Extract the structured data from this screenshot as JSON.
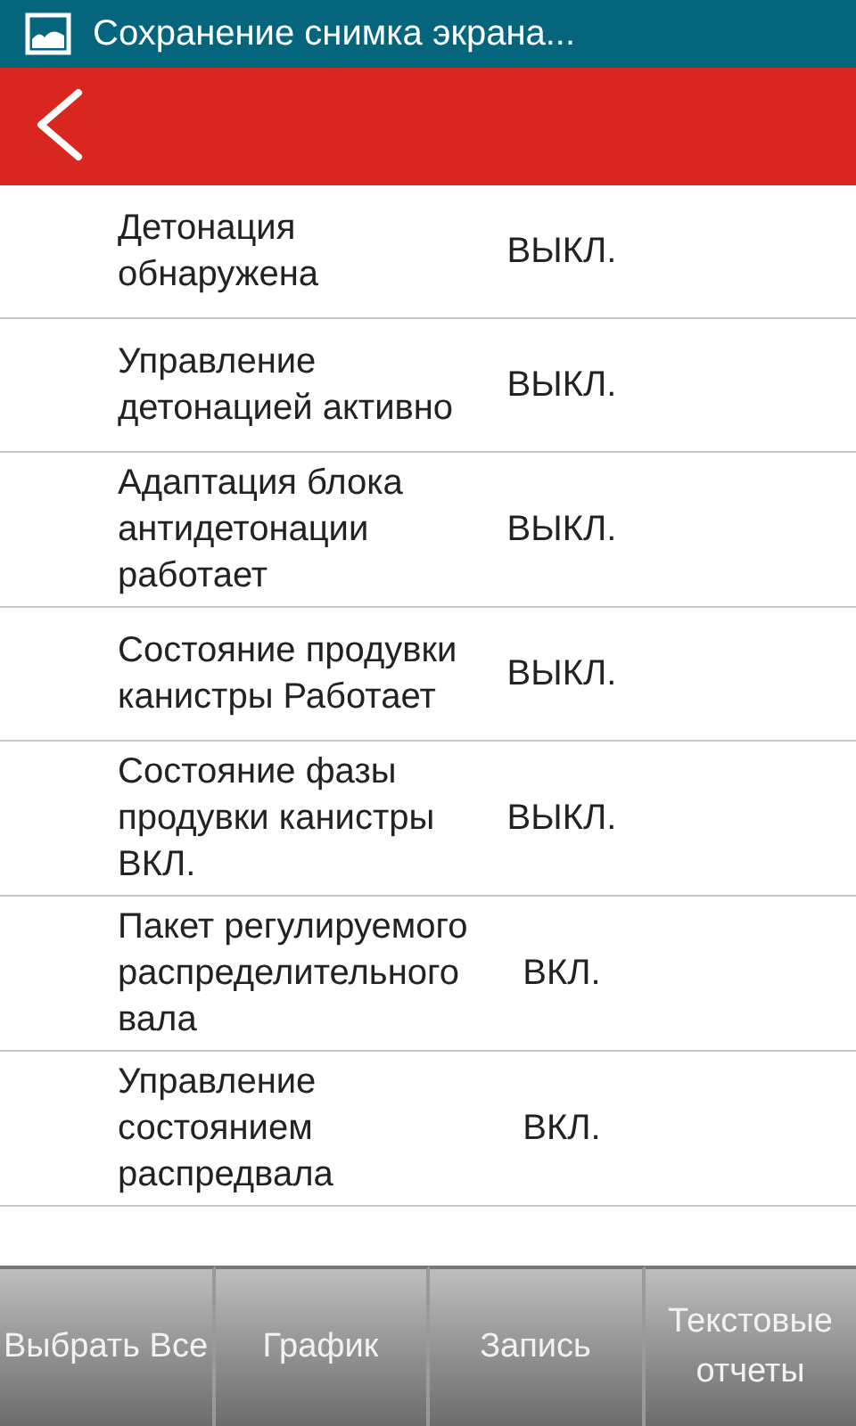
{
  "status_bar": {
    "notification": "Сохранение снимка экрана..."
  },
  "rows": [
    {
      "label": "Детонация обнаружена",
      "value": "ВЫКЛ."
    },
    {
      "label": "Управление детонацией активно",
      "value": "ВЫКЛ."
    },
    {
      "label": "Адаптация блока антидетонации работает",
      "value": "ВЫКЛ."
    },
    {
      "label": "Состояние продувки канистры Работает",
      "value": "ВЫКЛ."
    },
    {
      "label": "Состояние фазы продувки канистры ВКЛ.",
      "value": "ВЫКЛ."
    },
    {
      "label": "Пакет регулируемого распределительного вала",
      "value": "ВКЛ."
    },
    {
      "label": "Управление состоянием распредвала",
      "value": "ВКЛ."
    }
  ],
  "buttons": [
    "Выбрать Все",
    "График",
    "Запись",
    "Текстовые отчеты"
  ]
}
